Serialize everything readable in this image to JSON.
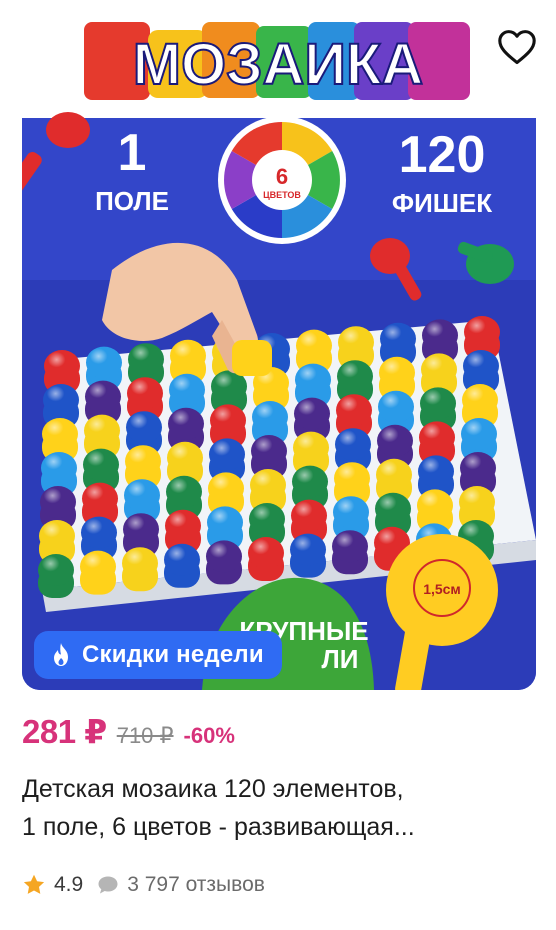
{
  "product": {
    "image": {
      "logo_text": "МОЗАИКА",
      "left_badge_number": "1",
      "left_badge_label": "ПОЛЕ",
      "center_badge_number": "6",
      "center_badge_label": "ЦВЕТОВ",
      "right_badge_number": "120",
      "right_badge_label": "ФИШЕК",
      "size_label": "1,5см",
      "bottom_banner_text_1": "КРУПНЫЕ",
      "bottom_banner_text_2": "ЛИ"
    },
    "promo_badge": "Скидки недели",
    "price": {
      "current": "281 ₽",
      "old": "710 ₽",
      "discount": "-60%"
    },
    "title_line_1": "Детская мозаика 120 элементов,",
    "title_line_2": "1 поле, 6 цветов - развивающая...",
    "rating": "4.9",
    "reviews": "3 797 отзывов"
  },
  "colors": {
    "price_accent": "#d7327a",
    "promo_blue": "#2f6bf3",
    "star": "#f5a623",
    "background_blue": "#2b3bb4"
  },
  "icons": {
    "favorite": "heart-outline-icon",
    "promo": "fire-icon",
    "rating": "star-icon",
    "reviews": "comment-bubble-icon"
  }
}
